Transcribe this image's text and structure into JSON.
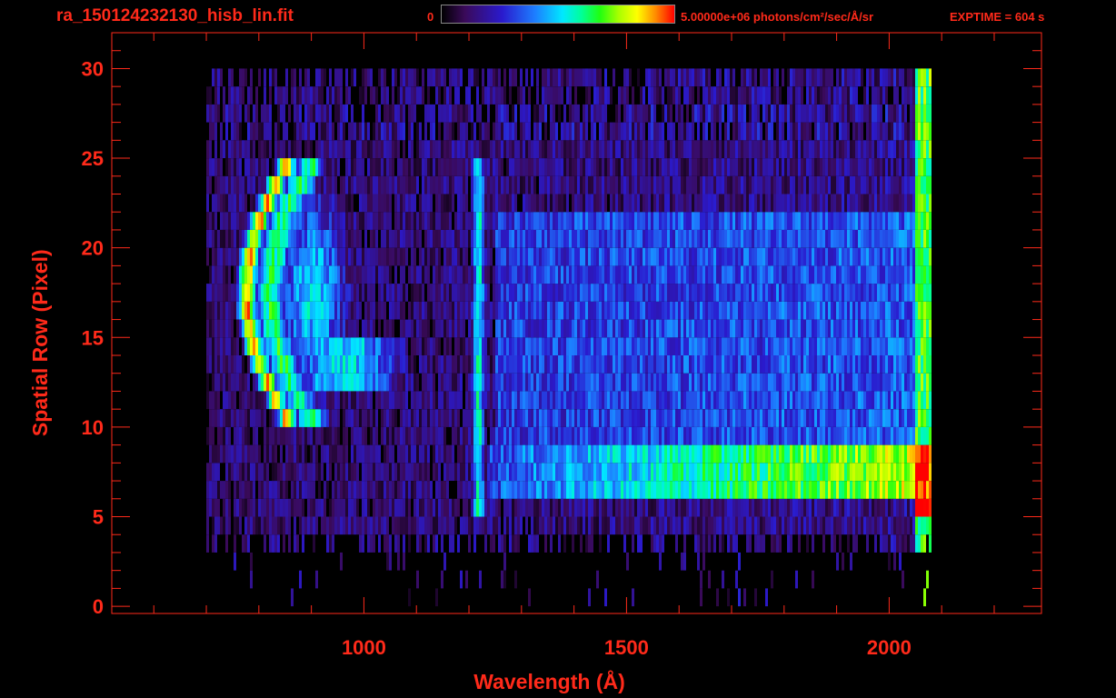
{
  "header": {
    "filename": "ra_150124232130_hisb_lin.fit",
    "colorbar_min": "0",
    "colorbar_max": "5.00000e+06 photons/cm²/sec/Å/sr",
    "exptime": "EXPTIME = 604 s"
  },
  "colors": {
    "axis": "#ff2a1a",
    "background": "#000000"
  },
  "chart_data": {
    "type": "heatmap",
    "title": "ra_150124232130_hisb_lin.fit",
    "xlabel": "Wavelength (Å)",
    "ylabel": "Spatial Row (Pixel)",
    "xlim": [
      520,
      2290
    ],
    "ylim": [
      -0.4,
      32
    ],
    "x_ticks": [
      1000,
      1500,
      2000
    ],
    "y_ticks": [
      0,
      5,
      10,
      15,
      20,
      25,
      30
    ],
    "colorbar": {
      "min": 0,
      "max": 5000000,
      "units": "photons/cm²/sec/Å/sr",
      "colormap": "rainbow"
    },
    "exptime_s": 604,
    "data_extent": {
      "x": [
        700,
        2080
      ],
      "y": [
        0,
        30
      ]
    },
    "features": [
      {
        "type": "emission_arc",
        "x": [
          760,
          960
        ],
        "y": [
          10,
          24
        ],
        "peak": 0.92
      },
      {
        "type": "emission_line",
        "x": 1216,
        "y": [
          5,
          24
        ],
        "peak": 0.55
      },
      {
        "type": "continuum_band",
        "y": [
          6,
          8
        ],
        "x": [
          1230,
          2080
        ],
        "peak": 0.85
      }
    ]
  }
}
